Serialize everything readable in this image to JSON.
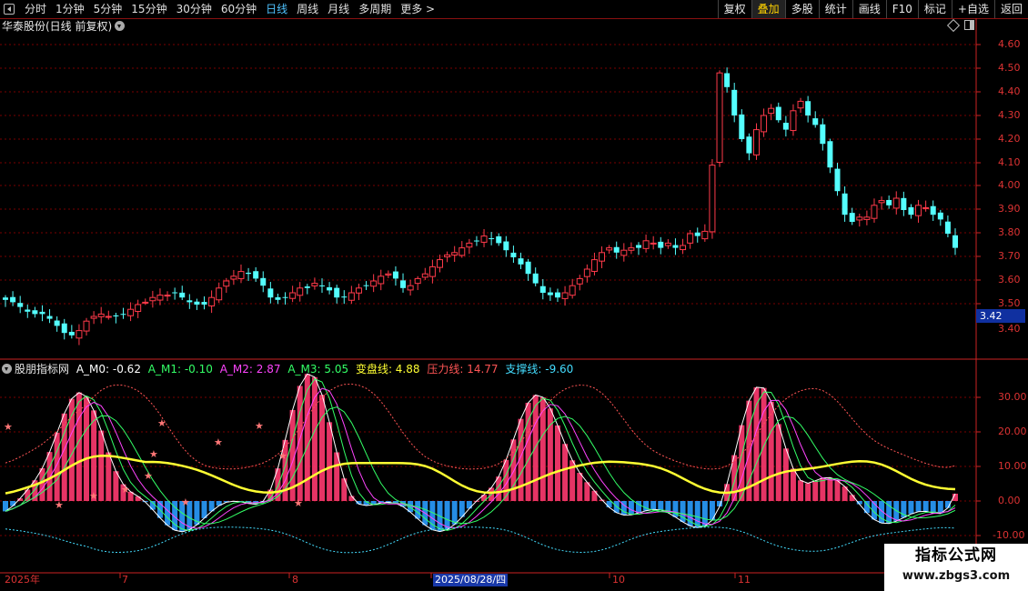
{
  "toolbar": {
    "periods": [
      "分时",
      "1分钟",
      "5分钟",
      "15分钟",
      "30分钟",
      "60分钟",
      "日线",
      "周线",
      "月线",
      "多周期",
      "更多 >"
    ],
    "active_period": "日线",
    "right_tools": [
      "复权",
      "叠加",
      "多股",
      "统计",
      "画线",
      "F10",
      "标记",
      "+自选",
      "返回"
    ],
    "active_tool": "叠加"
  },
  "stock": {
    "title": "华泰股份(日线 前复权)",
    "current_price_tag": "3.42"
  },
  "price_axis": {
    "labels": [
      "4.60",
      "4.50",
      "4.40",
      "4.30",
      "4.20",
      "4.10",
      "4.00",
      "3.90",
      "3.80",
      "3.70",
      "3.60",
      "3.50",
      "3.40"
    ]
  },
  "indicator": {
    "name": "股朋指标网",
    "items": [
      {
        "text": "A_M0: -0.62",
        "color": "#ffffff"
      },
      {
        "text": "A_M1: -0.10",
        "color": "#33ff66"
      },
      {
        "text": "A_M2: 2.87",
        "color": "#ff44ff"
      },
      {
        "text": "A_M3: 5.05",
        "color": "#33ff66"
      },
      {
        "text": "变盘线: 4.88",
        "color": "#ffff33"
      },
      {
        "text": "压力线: 14.77",
        "color": "#ff5555"
      },
      {
        "text": "支撑线: -9.60",
        "color": "#44ddff"
      }
    ],
    "axis_labels": [
      "30.00",
      "20.00",
      "10.00",
      "0.00",
      "-10.00"
    ]
  },
  "x_axis": {
    "labels": [
      "2025年",
      "7",
      "8",
      "10",
      "11"
    ],
    "cursor_date": "2025/08/28/四"
  },
  "watermark": {
    "line1": "指标公式网",
    "line2": "www.zbgs3.com"
  },
  "colors": {
    "up": "#ff3a4a",
    "down": "#54ffff",
    "grid": "#7a0000",
    "axis": "#cc2222"
  }
}
